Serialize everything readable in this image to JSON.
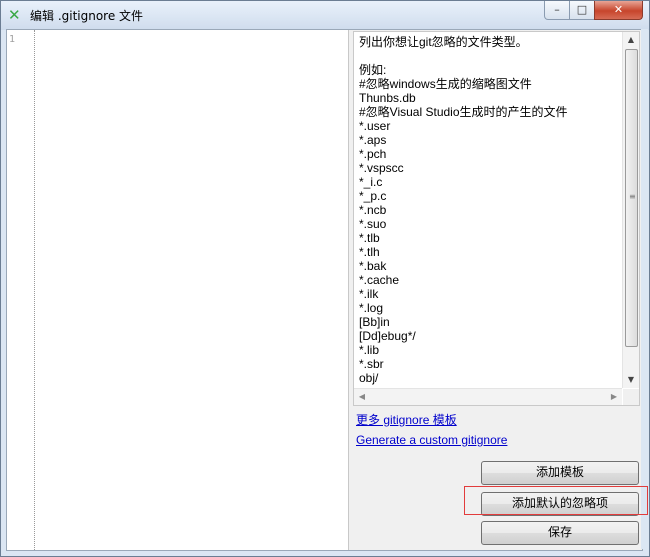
{
  "window": {
    "title": "编辑 .gitignore 文件",
    "controls": {
      "minimize": "–",
      "maximize": "□",
      "close": "✕"
    },
    "icon": "git-logo-icon"
  },
  "editor": {
    "line_numbers": [
      "1"
    ]
  },
  "help": {
    "text": "列出你想让git忽略的文件类型。\n\n例如:\n#忽略windows生成的缩略图文件\nThunbs.db\n#忽略Visual Studio生成时的产生的文件\n*.user\n*.aps\n*.pch\n*.vspscc\n*_i.c\n*_p.c\n*.ncb\n*.suo\n*.tlb\n*.tlh\n*.bak\n*.cache\n*.ilk\n*.log\n[Bb]in\n[Dd]ebug*/\n*.lib\n*.sbr\nobj/"
  },
  "links": {
    "more_templates": "更多 gitignore 模板",
    "generate_custom": "Generate a custom gitignore"
  },
  "buttons": {
    "add_template": "添加模板",
    "add_default_ignores": "添加默认的忽略项",
    "save": "保存"
  },
  "colors": {
    "highlight": "#e23c3c",
    "link": "#0000cc"
  }
}
